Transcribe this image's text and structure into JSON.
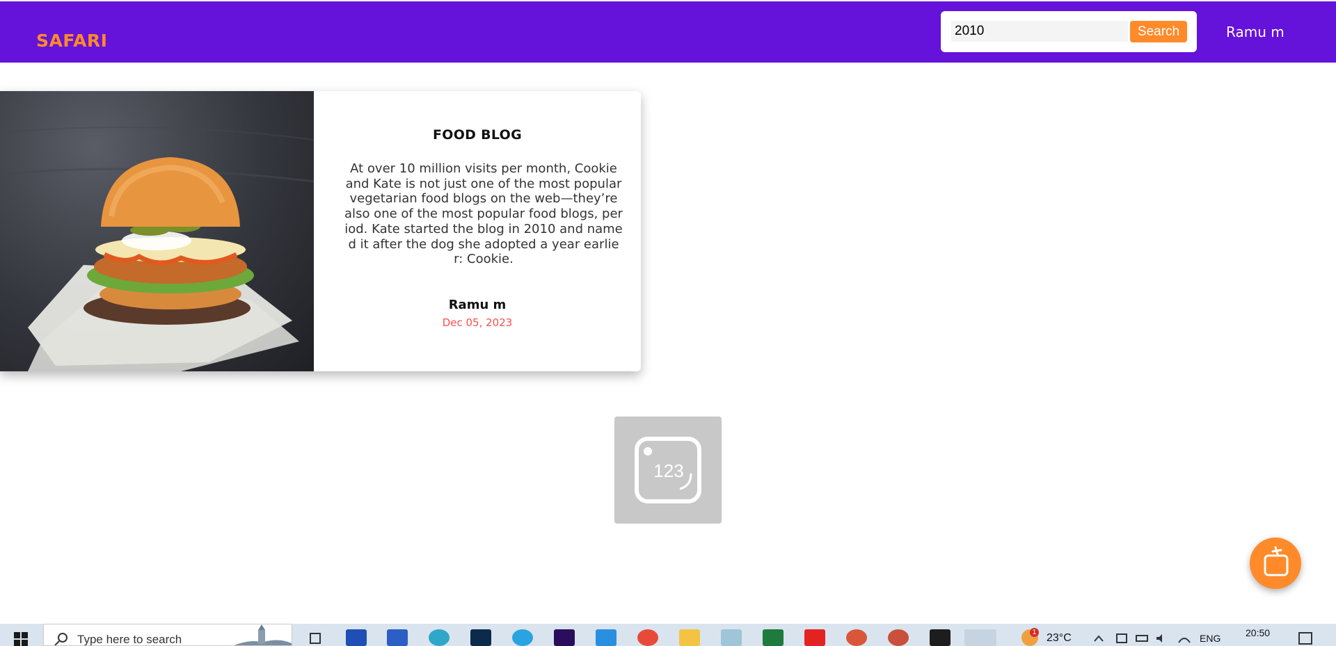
{
  "header": {
    "logo": "SAFARI",
    "search": {
      "value": "2010",
      "button_label": "Search"
    },
    "user_name": "Ramu m"
  },
  "card": {
    "title": "FOOD BLOG",
    "text": "At over 10 million visits per month, Cookie and Kate is not just one of the most popular vegetarian food blogs on the web—they’re also one of the most popular food blogs, period. Kate started the blog in 2010 and named it after the dog she adopted a year earlier: Cookie.",
    "author": "Ramu m",
    "date": "Dec 05, 2023"
  },
  "placeholder": {
    "label": "123"
  },
  "taskbar": {
    "search_placeholder": "Type here to search",
    "weather": "23°C",
    "weather_badge": "1",
    "language": "ENG",
    "time": "20:50",
    "apps": [
      "task-view",
      "l-app",
      "word",
      "edge",
      "photoshop",
      "telegram",
      "premiere",
      "vscode",
      "chrome",
      "file-explorer",
      "notepad",
      "excel",
      "youtube",
      "chrome-profile-1",
      "chrome-profile-2",
      "terminal",
      "chrome-active"
    ]
  },
  "colors": {
    "header": "#6512db",
    "accent": "#ff8a2a",
    "date": "#ff4d4d"
  }
}
